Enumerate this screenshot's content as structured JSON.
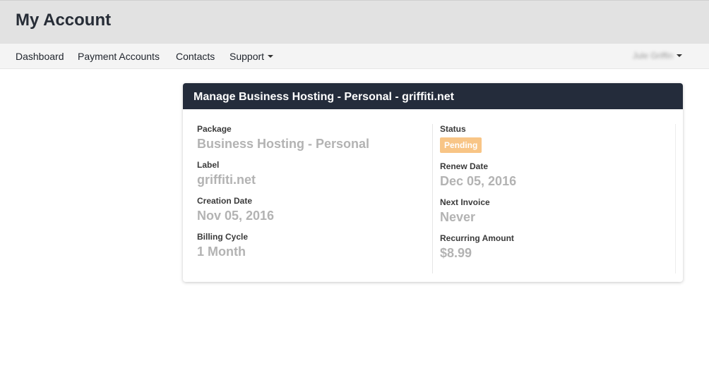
{
  "header": {
    "title": "My Account"
  },
  "nav": {
    "items": [
      {
        "label": "Dashboard"
      },
      {
        "label": "Payment Accounts"
      },
      {
        "label": "Contacts"
      },
      {
        "label": "Support"
      }
    ],
    "user": {
      "name": "Jule Griffin"
    }
  },
  "panel": {
    "title": "Manage Business Hosting - Personal - griffiti.net",
    "left": [
      {
        "label": "Package",
        "value": "Business Hosting - Personal"
      },
      {
        "label": "Label",
        "value": "griffiti.net"
      },
      {
        "label": "Creation Date",
        "value": "Nov 05, 2016"
      },
      {
        "label": "Billing Cycle",
        "value": "1 Month"
      }
    ],
    "status": {
      "label": "Status",
      "value": "Pending",
      "color": "#f8c586"
    },
    "right": [
      {
        "label": "Renew Date",
        "value": "Dec 05, 2016"
      },
      {
        "label": "Next Invoice",
        "value": "Never"
      },
      {
        "label": "Recurring Amount",
        "value": "$8.99"
      }
    ]
  }
}
